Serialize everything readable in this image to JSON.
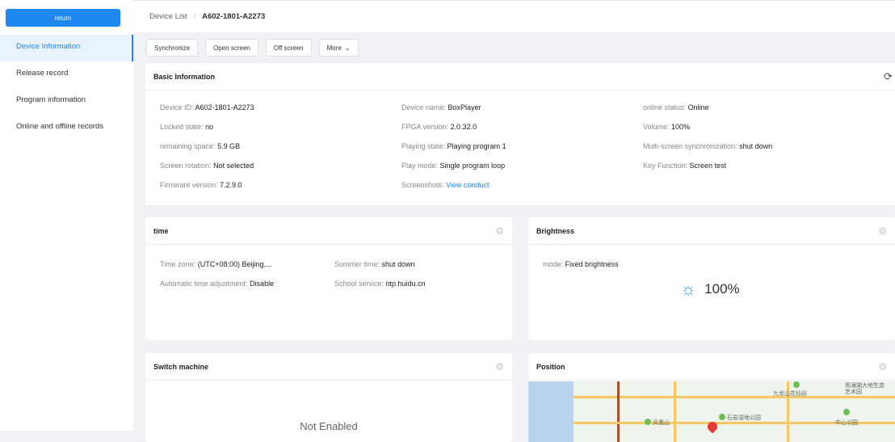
{
  "sidebar": {
    "return_label": "return",
    "items": [
      {
        "label": "Device Information",
        "active": true
      },
      {
        "label": "Release record",
        "active": false
      },
      {
        "label": "Program information",
        "active": false
      },
      {
        "label": "Online and offline records",
        "active": false
      }
    ]
  },
  "breadcrumb": {
    "parent": "Device List",
    "separator": "/",
    "current": "A602-1801-A2273"
  },
  "toolbar": {
    "synchronize": "Synchronize",
    "open_screen": "Open screen",
    "off_screen": "Off screen",
    "more": "More",
    "more_icon": "chevron-down-icon"
  },
  "basic": {
    "title": "Basic Information",
    "refresh_icon": "refresh-icon",
    "fields": {
      "device_id": {
        "label": "Device ID:",
        "value": "A602-1801-A2273"
      },
      "device_name": {
        "label": "Device name:",
        "value": "BoxPlayer"
      },
      "online_status": {
        "label": "online status:",
        "value": "Online"
      },
      "locked_state": {
        "label": "Locked state:",
        "value": "no"
      },
      "fpga_version": {
        "label": "FPGA version:",
        "value": "2.0.32.0"
      },
      "volume": {
        "label": "Volume:",
        "value": "100%"
      },
      "remaining_space": {
        "label": "remaining space:",
        "value": "5.9 GB"
      },
      "playing_state": {
        "label": "Playing state:",
        "value": "Playing program 1"
      },
      "multi_screen_sync": {
        "label": "Multi-screen synchronization:",
        "value": "shut down"
      },
      "screen_rotation": {
        "label": "Screen rotation:",
        "value": "Not selected"
      },
      "play_mode": {
        "label": "Play mode:",
        "value": "Single program loop"
      },
      "key_function": {
        "label": "Key Function:",
        "value": "Screen test"
      },
      "firmware_version": {
        "label": "Firmware version:",
        "value": "7.2.9.0"
      },
      "screenshots": {
        "label": "Screenshots:",
        "view": "View",
        "conduct": "conduct"
      }
    }
  },
  "time": {
    "title": "time",
    "settings_icon": "gear-icon",
    "time_zone": {
      "label": "Time zone:",
      "value": "(UTC+08:00) Beijing,..."
    },
    "summer_time": {
      "label": "Summer time:",
      "value": "shut down"
    },
    "auto_adjust": {
      "label": "Automatic time adjustment:",
      "value": "Disable"
    },
    "school_service": {
      "label": "School service:",
      "value": "ntp.huidu.cn"
    }
  },
  "brightness": {
    "title": "Brightness",
    "settings_icon": "gear-icon",
    "mode": {
      "label": "mode:",
      "value": "Fixed brightness"
    },
    "value": "100%",
    "icon": "sun-icon"
  },
  "switch_machine": {
    "title": "Switch machine",
    "settings_icon": "gear-icon",
    "status": "Not Enabled"
  },
  "position": {
    "title": "Position",
    "settings_icon": "gear-icon",
    "map_labels": [
      "九龙山花仙谷",
      "观澜湖大地生态艺术园",
      "凤凰山",
      "石岩湿地公园",
      "中心公园"
    ]
  },
  "colors": {
    "accent": "#1f87f0",
    "active_bg": "#e8f3fe",
    "page_bg": "#f0f2f5"
  }
}
